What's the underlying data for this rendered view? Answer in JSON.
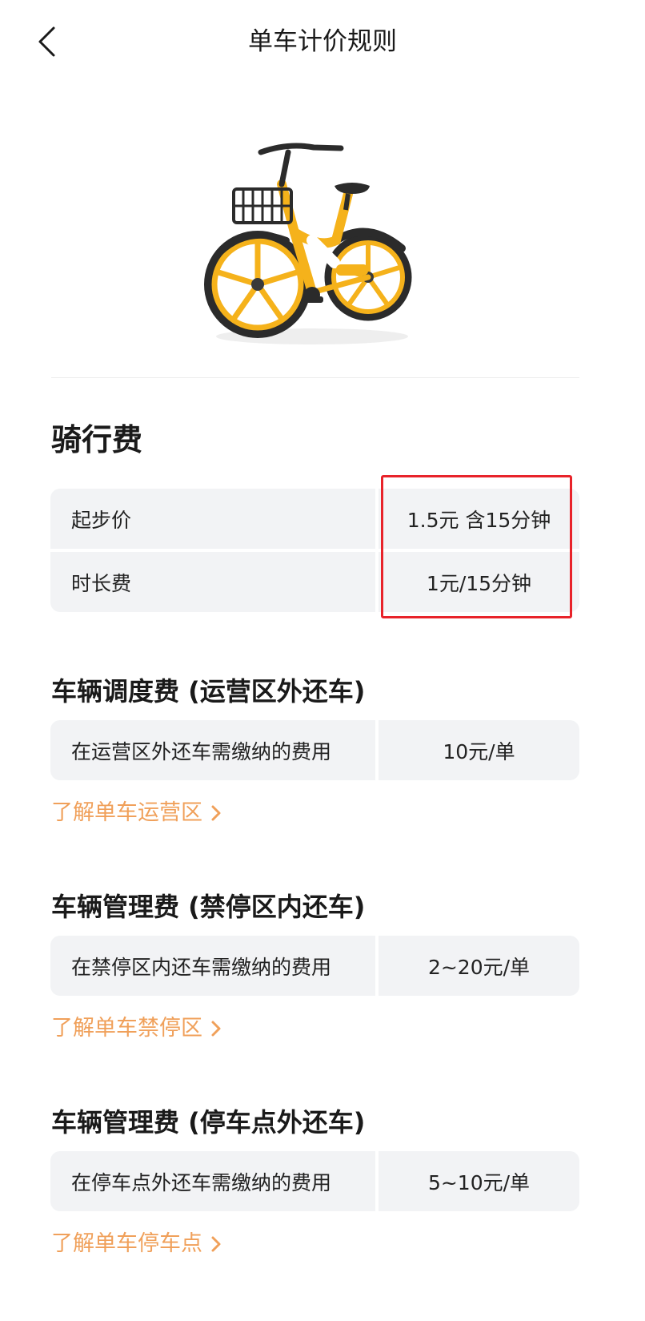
{
  "header": {
    "title": "单车计价规则"
  },
  "riding": {
    "title": "骑行费",
    "rows": [
      {
        "label": "起步价",
        "value": "1.5元  含15分钟"
      },
      {
        "label": "时长费",
        "value": "1元/15分钟"
      }
    ]
  },
  "dispatch": {
    "title": "车辆调度费 (运营区外还车)",
    "row": {
      "label": "在运营区外还车需缴纳的费用",
      "value": "10元/单"
    },
    "link": "了解单车运营区"
  },
  "no_parking": {
    "title": "车辆管理费 (禁停区内还车)",
    "row": {
      "label": "在禁停区内还车需缴纳的费用",
      "value": "2~20元/单"
    },
    "link": "了解单车禁停区"
  },
  "parking_point": {
    "title": "车辆管理费 (停车点外还车)",
    "row": {
      "label": "在停车点外还车需缴纳的费用",
      "value": "5~10元/单"
    },
    "link": "了解单车停车点"
  },
  "colors": {
    "accent_link": "#f0a05a",
    "highlight_box": "#e8232a",
    "bike_yellow": "#f5b21b",
    "cell_bg": "#f2f3f5"
  }
}
